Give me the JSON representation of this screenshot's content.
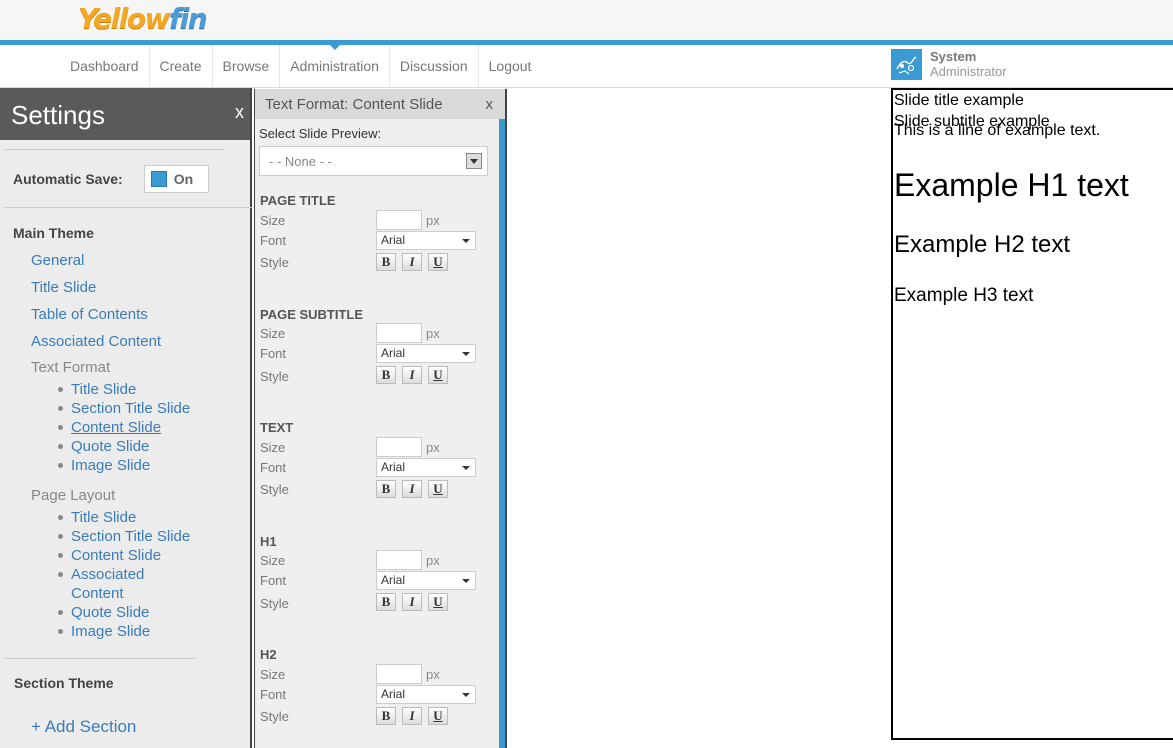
{
  "header": {
    "logo": {
      "part1": "Yellow",
      "part2": "fin"
    },
    "nav": [
      "Dashboard",
      "Create",
      "Browse",
      "Administration",
      "Discussion",
      "Logout"
    ],
    "active_nav": "Administration",
    "user": {
      "name": "System",
      "role": "Administrator"
    }
  },
  "settings": {
    "title": "Settings",
    "close": "x",
    "autosave": {
      "label": "Automatic Save:",
      "toggle": "On"
    },
    "main_theme": {
      "heading": "Main Theme",
      "links": [
        "General",
        "Title Slide",
        "Table of Contents",
        "Associated Content"
      ],
      "text_format": {
        "label": "Text Format",
        "items": [
          "Title Slide",
          "Section Title Slide",
          "Content Slide",
          "Quote Slide",
          "Image Slide"
        ]
      },
      "page_layout": {
        "label": "Page Layout",
        "items": [
          "Title Slide",
          "Section Title Slide",
          "Content Slide",
          "Associated Content",
          "Quote Slide",
          "Image Slide"
        ]
      }
    },
    "section_theme": {
      "heading": "Section Theme",
      "add": "+ Add Section"
    }
  },
  "text_format_panel": {
    "title": "Text Format: Content Slide",
    "close": "x",
    "preview_label": "Select Slide Preview:",
    "preview_value": "- - None - -",
    "row_labels": {
      "size": "Size",
      "font": "Font",
      "style": "Style",
      "unit": "px"
    },
    "style_buttons": [
      "B",
      "I",
      "U"
    ],
    "blocks": [
      {
        "heading": "PAGE TITLE",
        "font": "Arial"
      },
      {
        "heading": "PAGE SUBTITLE",
        "font": "Arial"
      },
      {
        "heading": "TEXT",
        "font": "Arial"
      },
      {
        "heading": "H1",
        "font": "Arial"
      },
      {
        "heading": "H2",
        "font": "Arial"
      }
    ]
  },
  "preview": {
    "title": "Slide title example",
    "subtitle": "Slide subtitle example",
    "text": "This is a line of example text.",
    "h1": "Example H1 text",
    "h2": "Example H2 text",
    "h3": "Example H3 text"
  },
  "colors": {
    "accent": "#3a9bd3",
    "link": "#3a7cb8",
    "logo_yellow": "#f5a623"
  }
}
